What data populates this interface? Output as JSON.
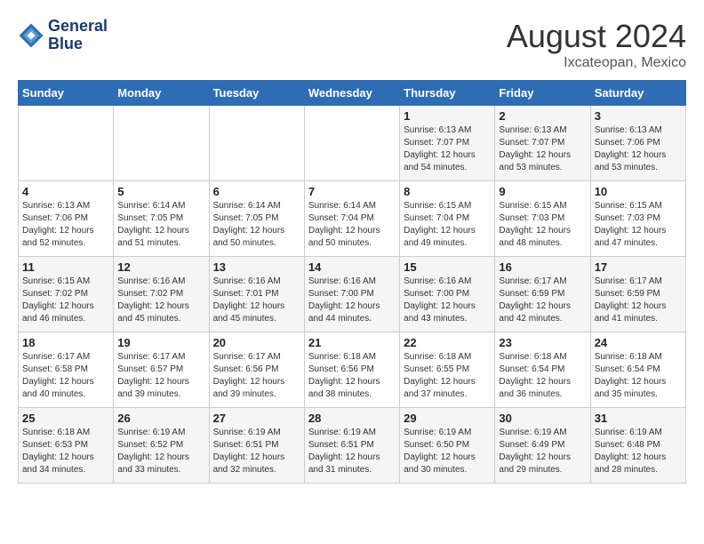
{
  "header": {
    "logo_line1": "General",
    "logo_line2": "Blue",
    "month_year": "August 2024",
    "location": "Ixcateopan, Mexico"
  },
  "days_of_week": [
    "Sunday",
    "Monday",
    "Tuesday",
    "Wednesday",
    "Thursday",
    "Friday",
    "Saturday"
  ],
  "weeks": [
    [
      {
        "day": "",
        "info": ""
      },
      {
        "day": "",
        "info": ""
      },
      {
        "day": "",
        "info": ""
      },
      {
        "day": "",
        "info": ""
      },
      {
        "day": "1",
        "info": "Sunrise: 6:13 AM\nSunset: 7:07 PM\nDaylight: 12 hours\nand 54 minutes."
      },
      {
        "day": "2",
        "info": "Sunrise: 6:13 AM\nSunset: 7:07 PM\nDaylight: 12 hours\nand 53 minutes."
      },
      {
        "day": "3",
        "info": "Sunrise: 6:13 AM\nSunset: 7:06 PM\nDaylight: 12 hours\nand 53 minutes."
      }
    ],
    [
      {
        "day": "4",
        "info": "Sunrise: 6:13 AM\nSunset: 7:06 PM\nDaylight: 12 hours\nand 52 minutes."
      },
      {
        "day": "5",
        "info": "Sunrise: 6:14 AM\nSunset: 7:05 PM\nDaylight: 12 hours\nand 51 minutes."
      },
      {
        "day": "6",
        "info": "Sunrise: 6:14 AM\nSunset: 7:05 PM\nDaylight: 12 hours\nand 50 minutes."
      },
      {
        "day": "7",
        "info": "Sunrise: 6:14 AM\nSunset: 7:04 PM\nDaylight: 12 hours\nand 50 minutes."
      },
      {
        "day": "8",
        "info": "Sunrise: 6:15 AM\nSunset: 7:04 PM\nDaylight: 12 hours\nand 49 minutes."
      },
      {
        "day": "9",
        "info": "Sunrise: 6:15 AM\nSunset: 7:03 PM\nDaylight: 12 hours\nand 48 minutes."
      },
      {
        "day": "10",
        "info": "Sunrise: 6:15 AM\nSunset: 7:03 PM\nDaylight: 12 hours\nand 47 minutes."
      }
    ],
    [
      {
        "day": "11",
        "info": "Sunrise: 6:15 AM\nSunset: 7:02 PM\nDaylight: 12 hours\nand 46 minutes."
      },
      {
        "day": "12",
        "info": "Sunrise: 6:16 AM\nSunset: 7:02 PM\nDaylight: 12 hours\nand 45 minutes."
      },
      {
        "day": "13",
        "info": "Sunrise: 6:16 AM\nSunset: 7:01 PM\nDaylight: 12 hours\nand 45 minutes."
      },
      {
        "day": "14",
        "info": "Sunrise: 6:16 AM\nSunset: 7:00 PM\nDaylight: 12 hours\nand 44 minutes."
      },
      {
        "day": "15",
        "info": "Sunrise: 6:16 AM\nSunset: 7:00 PM\nDaylight: 12 hours\nand 43 minutes."
      },
      {
        "day": "16",
        "info": "Sunrise: 6:17 AM\nSunset: 6:59 PM\nDaylight: 12 hours\nand 42 minutes."
      },
      {
        "day": "17",
        "info": "Sunrise: 6:17 AM\nSunset: 6:59 PM\nDaylight: 12 hours\nand 41 minutes."
      }
    ],
    [
      {
        "day": "18",
        "info": "Sunrise: 6:17 AM\nSunset: 6:58 PM\nDaylight: 12 hours\nand 40 minutes."
      },
      {
        "day": "19",
        "info": "Sunrise: 6:17 AM\nSunset: 6:57 PM\nDaylight: 12 hours\nand 39 minutes."
      },
      {
        "day": "20",
        "info": "Sunrise: 6:17 AM\nSunset: 6:56 PM\nDaylight: 12 hours\nand 39 minutes."
      },
      {
        "day": "21",
        "info": "Sunrise: 6:18 AM\nSunset: 6:56 PM\nDaylight: 12 hours\nand 38 minutes."
      },
      {
        "day": "22",
        "info": "Sunrise: 6:18 AM\nSunset: 6:55 PM\nDaylight: 12 hours\nand 37 minutes."
      },
      {
        "day": "23",
        "info": "Sunrise: 6:18 AM\nSunset: 6:54 PM\nDaylight: 12 hours\nand 36 minutes."
      },
      {
        "day": "24",
        "info": "Sunrise: 6:18 AM\nSunset: 6:54 PM\nDaylight: 12 hours\nand 35 minutes."
      }
    ],
    [
      {
        "day": "25",
        "info": "Sunrise: 6:18 AM\nSunset: 6:53 PM\nDaylight: 12 hours\nand 34 minutes."
      },
      {
        "day": "26",
        "info": "Sunrise: 6:19 AM\nSunset: 6:52 PM\nDaylight: 12 hours\nand 33 minutes."
      },
      {
        "day": "27",
        "info": "Sunrise: 6:19 AM\nSunset: 6:51 PM\nDaylight: 12 hours\nand 32 minutes."
      },
      {
        "day": "28",
        "info": "Sunrise: 6:19 AM\nSunset: 6:51 PM\nDaylight: 12 hours\nand 31 minutes."
      },
      {
        "day": "29",
        "info": "Sunrise: 6:19 AM\nSunset: 6:50 PM\nDaylight: 12 hours\nand 30 minutes."
      },
      {
        "day": "30",
        "info": "Sunrise: 6:19 AM\nSunset: 6:49 PM\nDaylight: 12 hours\nand 29 minutes."
      },
      {
        "day": "31",
        "info": "Sunrise: 6:19 AM\nSunset: 6:48 PM\nDaylight: 12 hours\nand 28 minutes."
      }
    ]
  ]
}
